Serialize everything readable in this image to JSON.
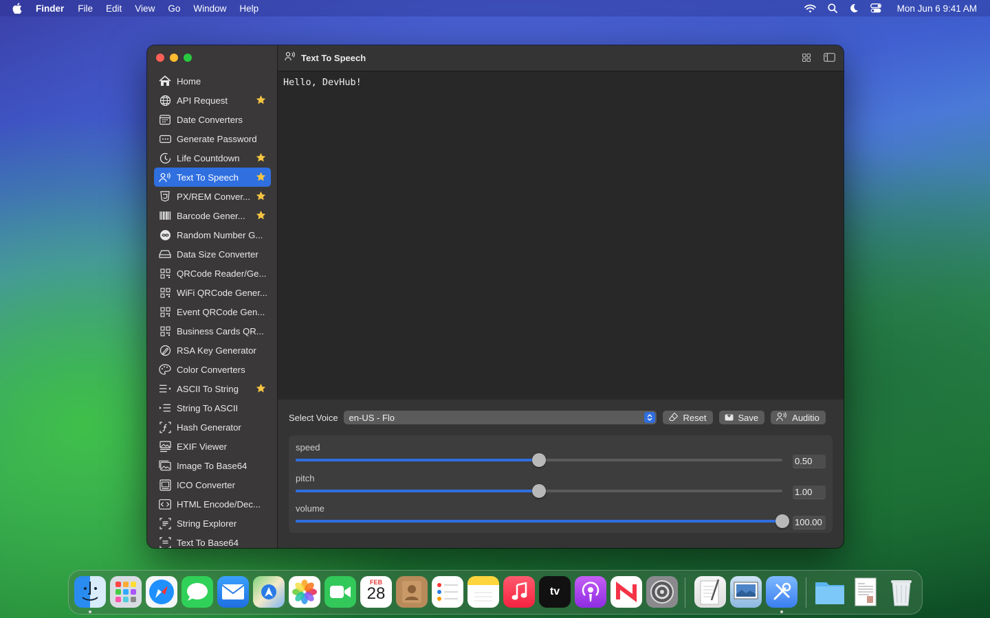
{
  "menubar": {
    "app_name": "Finder",
    "items": [
      "File",
      "Edit",
      "View",
      "Go",
      "Window",
      "Help"
    ],
    "datetime": "Mon Jun 6  9:41 AM"
  },
  "window": {
    "title": "Text To Speech",
    "sidebar": {
      "items": [
        {
          "label": "Home",
          "icon": "house-icon",
          "starred": false
        },
        {
          "label": "API Request",
          "icon": "globe-icon",
          "starred": true
        },
        {
          "label": "Date Converters",
          "icon": "calendar-icon",
          "starred": false
        },
        {
          "label": "Generate Password",
          "icon": "password-icon",
          "starred": false
        },
        {
          "label": "Life Countdown",
          "icon": "timer-icon",
          "starred": true
        },
        {
          "label": "Text To Speech",
          "icon": "speech-person-icon",
          "starred": true,
          "active": true
        },
        {
          "label": "PX/REM Conver...",
          "icon": "css-icon",
          "starred": true
        },
        {
          "label": "Barcode Gener...",
          "icon": "barcode-icon",
          "starred": true
        },
        {
          "label": "Random Number G...",
          "icon": "infinity-icon",
          "starred": false
        },
        {
          "label": "Data Size Converter",
          "icon": "drive-icon",
          "starred": false
        },
        {
          "label": "QRCode Reader/Ge...",
          "icon": "qrcode-icon",
          "starred": false
        },
        {
          "label": "WiFi QRCode Gener...",
          "icon": "qrcode-icon",
          "starred": false
        },
        {
          "label": "Event QRCode Gen...",
          "icon": "qrcode-icon",
          "starred": false
        },
        {
          "label": "Business Cards QR...",
          "icon": "qrcode-icon",
          "starred": false
        },
        {
          "label": "RSA Key Generator",
          "icon": "signature-icon",
          "starred": false
        },
        {
          "label": "Color Converters",
          "icon": "palette-icon",
          "starred": false
        },
        {
          "label": "ASCII To String",
          "icon": "list-arrow-left-icon",
          "starred": true
        },
        {
          "label": "String To ASCII",
          "icon": "list-arrow-right-icon",
          "starred": false
        },
        {
          "label": "Hash Generator",
          "icon": "function-icon",
          "starred": false
        },
        {
          "label": "EXIF Viewer",
          "icon": "photo-text-icon",
          "starred": false
        },
        {
          "label": "Image To Base64",
          "icon": "photo-stack-icon",
          "starred": false
        },
        {
          "label": "ICO Converter",
          "icon": "photo-frame-icon",
          "starred": false
        },
        {
          "label": "HTML Encode/Dec...",
          "icon": "code-icon",
          "starred": false
        },
        {
          "label": "String Explorer",
          "icon": "text-search-icon",
          "starred": false
        },
        {
          "label": "Text To Base64",
          "icon": "text-doc-icon",
          "starred": false
        }
      ]
    },
    "editor": {
      "text": "Hello, DevHub!"
    },
    "controls": {
      "voice_label": "Select Voice",
      "voice_value": "en-US - Flo",
      "reset_label": "Reset",
      "save_label": "Save",
      "audition_label": "Auditio"
    },
    "params": [
      {
        "name": "speed",
        "value": "0.50",
        "fraction": 0.5
      },
      {
        "name": "pitch",
        "value": "1.00",
        "fraction": 0.5
      },
      {
        "name": "volume",
        "value": "100.00",
        "fraction": 1.0
      }
    ]
  },
  "dock": {
    "apps": [
      "Finder",
      "Launchpad",
      "Safari",
      "Messages",
      "Mail",
      "Maps",
      "Photos",
      "FaceTime",
      "Calendar",
      "Contacts",
      "Reminders",
      "Notes",
      "Music",
      "TV",
      "Podcasts",
      "News",
      "System Settings",
      "TextEdit",
      "Preview",
      "DevHub",
      "Downloads",
      "Document",
      "Trash"
    ],
    "calendar_month": "FEB",
    "calendar_day": "28",
    "tv_label": "tv"
  },
  "colors": {
    "accent": "#2f6fe0",
    "star": "#f5c542"
  }
}
